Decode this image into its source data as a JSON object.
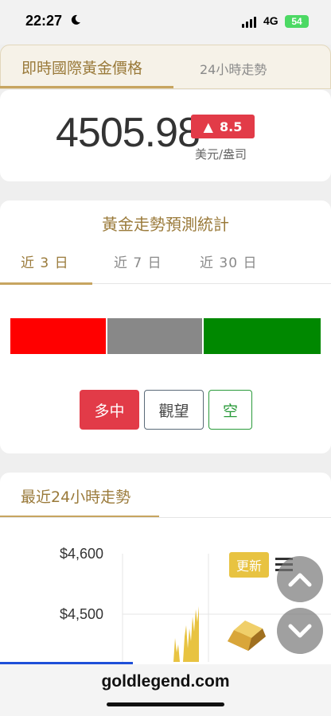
{
  "status_bar": {
    "time": "22:27",
    "network": "4G",
    "battery": "54"
  },
  "top_tabs": {
    "live": "即時國際黃金價格",
    "trend24": "24小時走勢"
  },
  "price": {
    "value": "4505.98",
    "change": "8.5",
    "change_arrow": "▲",
    "unit": "美元/盎司",
    "up_color": "#e23b48"
  },
  "forecast": {
    "title": "黃金走勢預測統計",
    "tabs": [
      "近 3 日",
      "近 7 日",
      "近 30 日"
    ],
    "active_tab": 0,
    "distribution": [
      {
        "label": "多",
        "fraction": 0.31,
        "color": "#ff0000"
      },
      {
        "label": "觀望",
        "fraction": 0.31,
        "color": "#888888"
      },
      {
        "label": "空",
        "fraction": 0.38,
        "color": "#008800"
      }
    ],
    "buttons": {
      "bull": "多中",
      "hold": "觀望",
      "bear": "空"
    }
  },
  "trend": {
    "title": "最近24小時走勢",
    "y_labels": [
      "$4,600",
      "$4,500"
    ],
    "refresh": "更新"
  },
  "footer": {
    "domain": "goldlegend.com"
  },
  "icons": {
    "moon": "moon-icon",
    "menu": "menu-icon",
    "up": "chevron-up-icon",
    "down": "chevron-down-icon",
    "gold_bar": "gold-bar-icon"
  }
}
